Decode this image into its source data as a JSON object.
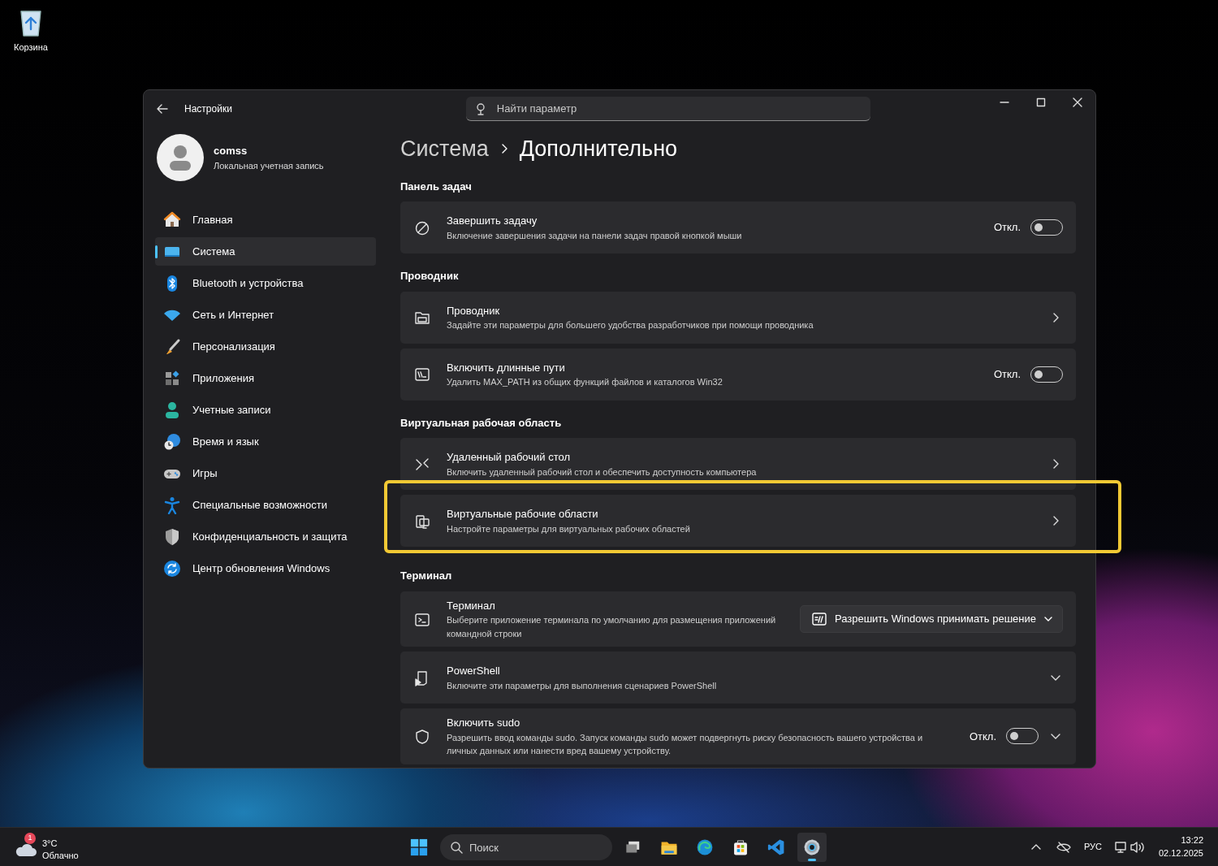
{
  "desktop_icons": [
    {
      "label": "Корзина"
    }
  ],
  "window": {
    "title": "Настройки",
    "search": {
      "placeholder": "Найти параметр"
    }
  },
  "profile": {
    "name": "comss",
    "account_type": "Локальная учетная запись"
  },
  "sidebar": {
    "items": [
      {
        "label": "Главная",
        "selected": false
      },
      {
        "label": "Система",
        "selected": true
      },
      {
        "label": "Bluetooth и устройства",
        "selected": false
      },
      {
        "label": "Сеть и Интернет",
        "selected": false
      },
      {
        "label": "Персонализация",
        "selected": false
      },
      {
        "label": "Приложения",
        "selected": false
      },
      {
        "label": "Учетные записи",
        "selected": false
      },
      {
        "label": "Время и язык",
        "selected": false
      },
      {
        "label": "Игры",
        "selected": false
      },
      {
        "label": "Специальные возможности",
        "selected": false
      },
      {
        "label": "Конфиденциальность и защита",
        "selected": false
      },
      {
        "label": "Центр обновления Windows",
        "selected": false
      }
    ]
  },
  "breadcrumb": [
    "Система",
    "Дополнительно"
  ],
  "sections": [
    {
      "title": "Панель задач",
      "items": [
        {
          "kind": "toggle",
          "title": "Завершить задачу",
          "description": "Включение завершения задачи на панели задач правой кнопкой мыши",
          "state_label": "Откл.",
          "on": false,
          "highlighted": false
        }
      ]
    },
    {
      "title": "Проводник",
      "items": [
        {
          "kind": "link",
          "title": "Проводник",
          "description": "Задайте эти параметры для большего удобства разработчиков при помощи проводника",
          "highlighted": false
        },
        {
          "kind": "toggle",
          "title": "Включить длинные пути",
          "description": "Удалить MAX_PATH из общих функций файлов и каталогов Win32",
          "state_label": "Откл.",
          "on": false,
          "highlighted": false
        }
      ]
    },
    {
      "title": "Виртуальная рабочая область",
      "items": [
        {
          "kind": "link",
          "title": "Удаленный рабочий стол",
          "description": "Включить удаленный рабочий стол и обеспечить доступность компьютера",
          "highlighted": false
        },
        {
          "kind": "link",
          "title": "Виртуальные рабочие области",
          "description": "Настройте параметры для виртуальных рабочих областей",
          "highlighted": true
        }
      ]
    },
    {
      "title": "Терминал",
      "items": [
        {
          "kind": "select",
          "title": "Терминал",
          "description": "Выберите приложение терминала по умолчанию для размещения приложений командной строки",
          "value": "Разрешить Windows принимать решение",
          "highlighted": false
        },
        {
          "kind": "expander",
          "title": "PowerShell",
          "description": "Включите эти параметры для выполнения сценариев PowerShell",
          "highlighted": false
        },
        {
          "kind": "toggle_expander",
          "title": "Включить sudo",
          "description": "Разрешить ввод команды sudo. Запуск команды sudo может подвергнуть риску безопасность вашего устройства и личных данных или нанести вред вашему устройству.",
          "state_label": "Откл.",
          "on": false,
          "highlighted": false
        }
      ]
    }
  ],
  "taskbar": {
    "weather": {
      "badge": "1",
      "temperature": "3°C",
      "condition": "Облачно"
    },
    "search": {
      "placeholder": "Поиск"
    },
    "apps": [
      {
        "active": false
      },
      {
        "active": false
      },
      {
        "active": false
      },
      {
        "active": false
      },
      {
        "active": false
      },
      {
        "active": true
      }
    ],
    "language": "РУС",
    "time": "13:22",
    "date": "02.12.2025"
  }
}
